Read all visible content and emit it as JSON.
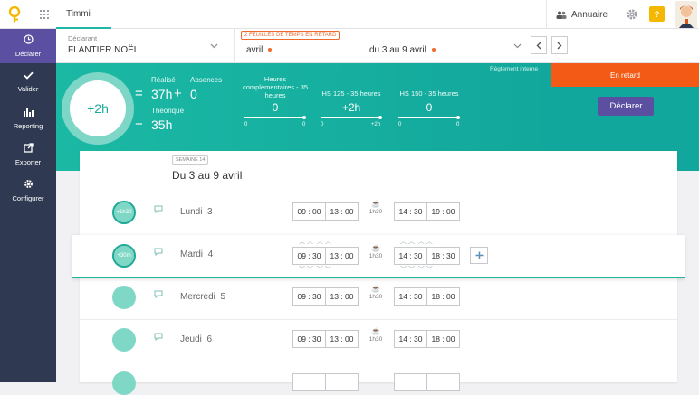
{
  "topbar": {
    "app_name": "Timmi",
    "directory_label": "Annuaire",
    "help_label": "?"
  },
  "sidebar": {
    "items": [
      {
        "label": "Déclarer",
        "icon": "clock-icon",
        "glyph": "◷"
      },
      {
        "label": "Valider",
        "icon": "check-icon",
        "glyph": "✓"
      },
      {
        "label": "Reporting",
        "icon": "bar-chart-icon",
        "glyph": "ılıl"
      },
      {
        "label": "Exporter",
        "icon": "export-icon",
        "glyph": "⇱"
      },
      {
        "label": "Configurer",
        "icon": "gear-icon",
        "glyph": "✲"
      }
    ]
  },
  "declarant": {
    "label": "Déclarant",
    "name": "FLANTIER NOËL",
    "late_badge": "2 FEUILLES DE TEMPS EN RETARD",
    "month": "avril",
    "period": "du 3 au 9 avril"
  },
  "summary": {
    "total": "+2h",
    "realise_label": "Réalisé",
    "absences_label": "Absences",
    "realise_value": "37h",
    "absences_value": "0",
    "theorique_label": "Théorique",
    "theorique_value": "35h",
    "equals": "=",
    "plus": "+",
    "minus": "−",
    "reglement": "Règlement interne",
    "hs": [
      {
        "title": "Heures complémentaires - 35 heures",
        "value": "0",
        "min": "0",
        "max": "0"
      },
      {
        "title": "HS 125 - 35 heures",
        "value": "+2h",
        "min": "0",
        "max": "+2h"
      },
      {
        "title": "HS 150 - 35 heures",
        "value": "0",
        "min": "0",
        "max": "0"
      }
    ]
  },
  "late_panel": {
    "status": "En retard",
    "declare_button": "Déclarer"
  },
  "week": {
    "badge": "SEMAINE 14",
    "title": "Du 3 au 9 avril",
    "days": [
      {
        "name": "Lundi",
        "num": "3",
        "badge": "+1h30",
        "am_start": "09 : 00",
        "am_end": "13 : 00",
        "pause": "1h30",
        "pm_start": "14 : 30",
        "pm_end": "19 : 00"
      },
      {
        "name": "Mardi",
        "num": "4",
        "badge": "+30m",
        "am_start": "09 : 30",
        "am_end": "13 : 00",
        "pause": "1h30",
        "pm_start": "14 : 30",
        "pm_end": "18 : 30"
      },
      {
        "name": "Mercredi",
        "num": "5",
        "badge": "",
        "am_start": "09 : 30",
        "am_end": "13 : 00",
        "pause": "1h30",
        "pm_start": "14 : 30",
        "pm_end": "18 : 00"
      },
      {
        "name": "Jeudi",
        "num": "6",
        "badge": "",
        "am_start": "09 : 30",
        "am_end": "13 : 00",
        "pause": "1h30",
        "pm_start": "14 : 30",
        "pm_end": "18 : 00"
      }
    ]
  },
  "colors": {
    "teal": "#1cb6a1",
    "purple": "#5a4fa0",
    "orange": "#f25a16",
    "sidebar": "#2f3a52"
  }
}
